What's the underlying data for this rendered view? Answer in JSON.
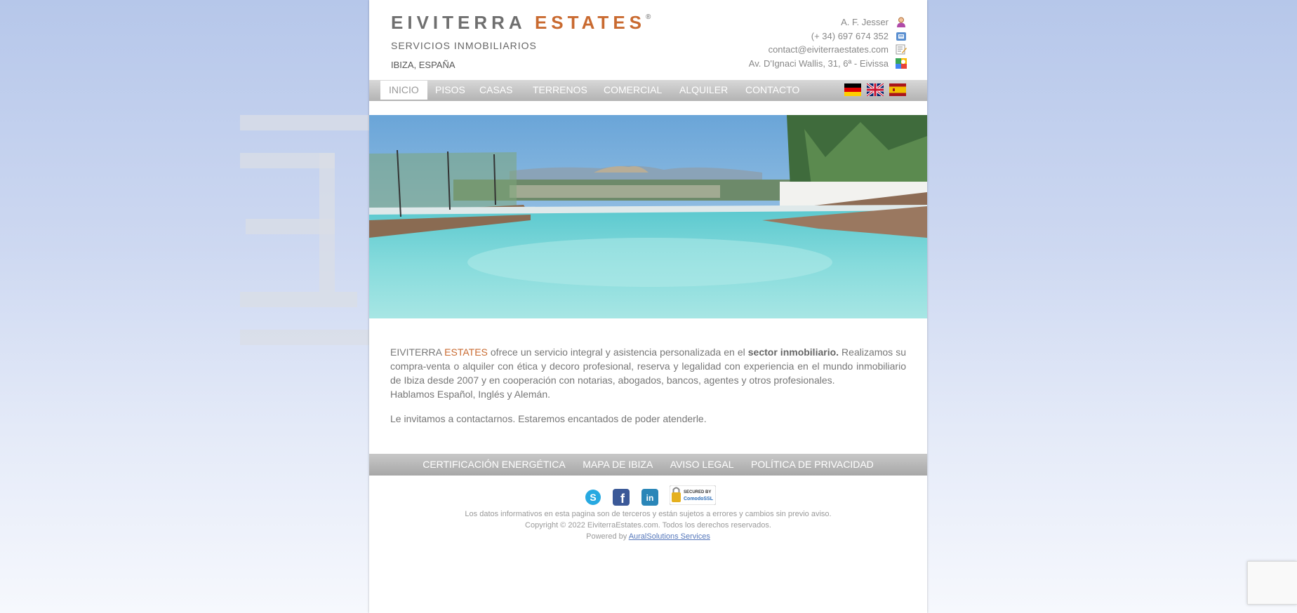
{
  "brand": {
    "name_part1": "EIVITERRA",
    "name_part2": "ESTATES",
    "registered": "®",
    "subtitle": "SERVICIOS INMOBILIARIOS",
    "location": "IBIZA, ESPAÑA"
  },
  "contact": {
    "person": "A. F. Jesser",
    "phone": "(+ 34) 697 674 352",
    "email": "contact@eiviterraestates.com",
    "address": "Av. D'Ignaci Wallis, 31, 6ª - Eivissa"
  },
  "nav": {
    "items": [
      {
        "label": "INICIO"
      },
      {
        "label": "PISOS"
      },
      {
        "label": "CASAS"
      },
      {
        "label": "TERRENOS"
      },
      {
        "label": "COMERCIAL"
      },
      {
        "label": "ALQUILER"
      },
      {
        "label": "CONTACTO"
      }
    ],
    "active": "INICIO"
  },
  "languages": [
    {
      "code": "de",
      "icon": "german-flag-icon"
    },
    {
      "code": "en",
      "icon": "uk-flag-icon"
    },
    {
      "code": "es",
      "icon": "spanish-flag-icon"
    }
  ],
  "intro": {
    "brand_part1": "EIVITERRA",
    "brand_part2": "ESTATES",
    "text1": "ofrece un servicio integral y asistencia personalizada en el",
    "bold": "sector inmobiliario.",
    "text2": "Realizamos su compra-venta o alquiler con ética y decoro profesional, reserva y legalidad con experiencia en el mundo inmobiliario de Ibiza desde 2007 y en cooperación con notarias, abogados, bancos, agentes y otros profesionales.",
    "languages_line": "Hablamos Español, Inglés y  Alemán.",
    "invite": "Le invitamos a contactarnos. Estaremos encantados de poder atenderle."
  },
  "footer": {
    "links": [
      {
        "label": "CERTIFICACIÓN ENERGÉTICA"
      },
      {
        "label": "MAPA DE IBIZA"
      },
      {
        "label": "AVISO LEGAL"
      },
      {
        "label": "POLÍTICA DE PRIVACIDAD"
      }
    ],
    "social": [
      {
        "icon": "skype-icon"
      },
      {
        "icon": "facebook-icon"
      },
      {
        "icon": "linkedin-icon"
      }
    ],
    "ssl_badge": {
      "line1": "SECURED BY",
      "line2": "ComodoSSL"
    },
    "disclaimer": "Los datos informativos en esta pagina son de terceros y están sujetos a errores y cambios sin previo aviso.",
    "copyright": "Copyright © 2022 EiviterraEstates.com. Todos los derechos reservados.",
    "powered_prefix": "Powered by",
    "powered_link": "AuralSolutions Services"
  },
  "colors": {
    "accent": "#c96a30",
    "text": "#777777",
    "nav_bg": "#bcbcbc",
    "bg_top": "#b6c7ea"
  }
}
